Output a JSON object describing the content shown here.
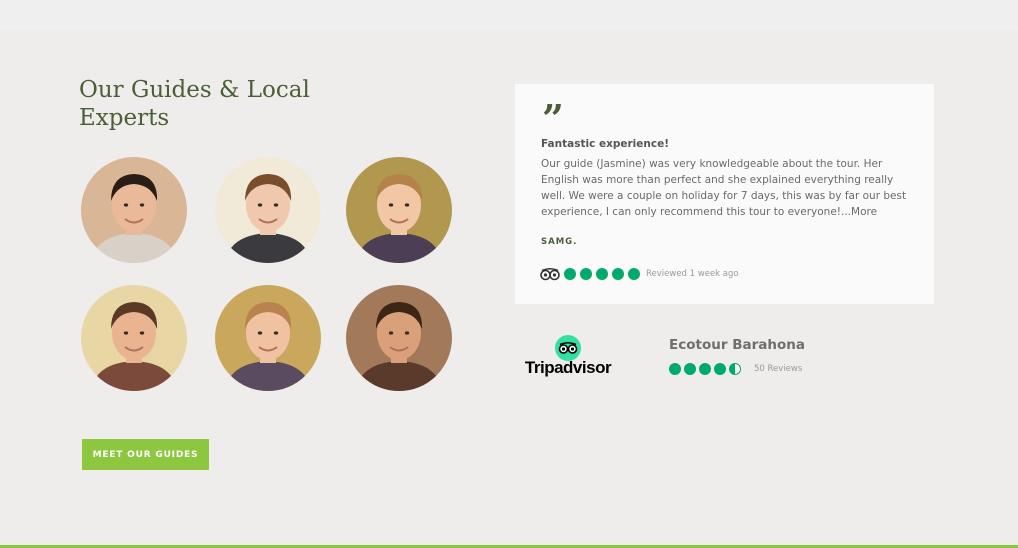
{
  "section": {
    "title": "Our Guides & Local Experts",
    "cta_label": "MEET OUR GUIDES"
  },
  "guides": [
    {
      "name": "guide-1",
      "skin": "#e9b99a",
      "hair": "#2a1d16",
      "bg": "#d9b796",
      "shirt": "#d8d1c8"
    },
    {
      "name": "guide-2",
      "skin": "#f0c8ae",
      "hair": "#7a4d2b",
      "bg": "#f2ead9",
      "shirt": "#3b3b3f"
    },
    {
      "name": "guide-3",
      "skin": "#f1c7a6",
      "hair": "#b5834a",
      "bg": "#b2984f",
      "shirt": "#4b3e55"
    },
    {
      "name": "guide-4",
      "skin": "#e9b48f",
      "hair": "#5a3a24",
      "bg": "#e8d6a4",
      "shirt": "#7b4a3a"
    },
    {
      "name": "guide-5",
      "skin": "#f0c2a2",
      "hair": "#b8834e",
      "bg": "#c9a85e",
      "shirt": "#5a4b60"
    },
    {
      "name": "guide-6",
      "skin": "#d9a07a",
      "hair": "#3d2616",
      "bg": "#a27a5a",
      "shirt": "#5a3a2b"
    }
  ],
  "review": {
    "title": "Fantastic experience!",
    "body": "Our guide (Jasmine) was very knowledgeable about the tour. Her English was more than perfect and she explained everything really well. We were a couple on holiday for 7 days, this was by far our best experience, I can only recommend this tour to everyone!...More",
    "author": "SAMG.",
    "rating": 5,
    "reviewed_text": "Reviewed 1 week ago"
  },
  "tripadvisor": {
    "logo_text": "Tripadvisor",
    "business_name": "Ecotour Barahona",
    "rating": 4.5,
    "reviews_count": "50 Reviews"
  },
  "colors": {
    "accent_green": "#8dc63f",
    "heading_green": "#4b5e37",
    "ta_green": "#00aa6c",
    "ta_mint": "#34e0a1"
  }
}
